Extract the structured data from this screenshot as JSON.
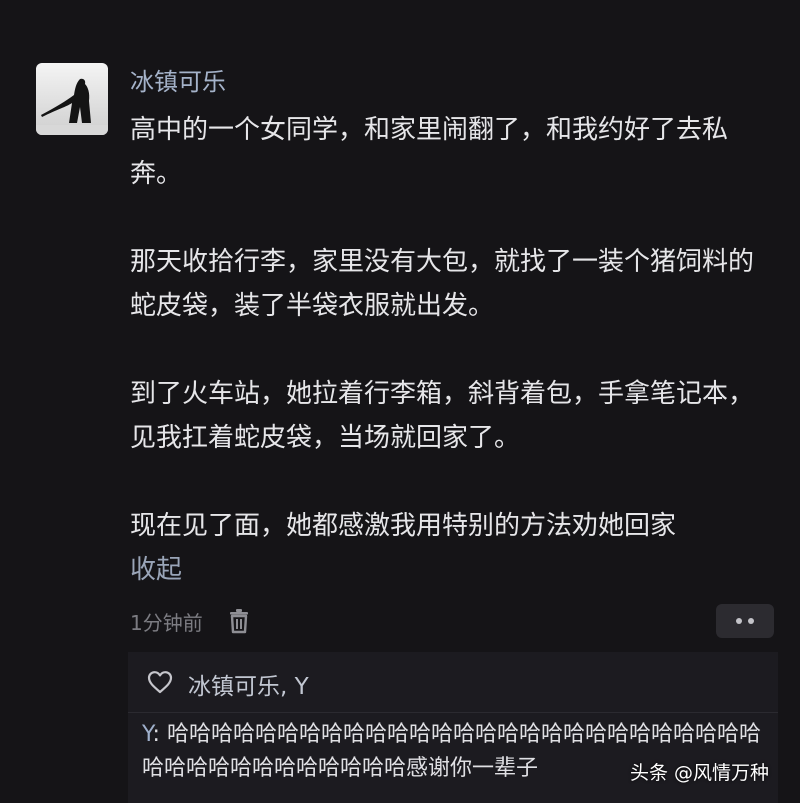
{
  "comment": {
    "username": "冰镇可乐",
    "paragraphs": [
      "高中的一个女同学，和家里闹翻了，和我约好了去私奔。",
      "那天收拾行李，家里没有大包，就找了一装个猪饲料的蛇皮袋，装了半袋衣服就出发。",
      "到了火车站，她拉着行李箱，斜背着包，手拿笔记本，见我扛着蛇皮袋，当场就回家了。",
      "现在见了面，她都感激我用特别的方法劝她回家"
    ],
    "collapse_label": "收起",
    "time": "1分钟前",
    "icons": {
      "avatar": "silhouette-avatar",
      "delete": "trash-icon",
      "more": "more-icon",
      "like": "heart-icon"
    }
  },
  "reply_section": {
    "liked_by": "冰镇可乐, Y",
    "reply_author": "Y",
    "reply_separator": ": ",
    "reply_text": "哈哈哈哈哈哈哈哈哈哈哈哈哈哈哈哈哈哈哈哈哈哈哈哈哈哈哈哈哈哈哈哈哈哈哈哈哈哈哈感谢你一辈子"
  },
  "watermark": "头条 @风情万种",
  "colors": {
    "background": "#151417",
    "username": "#a5b3ca",
    "body_text": "#e6e6e9",
    "link": "#9aa5b8",
    "reply_box": "#1c1b20"
  }
}
